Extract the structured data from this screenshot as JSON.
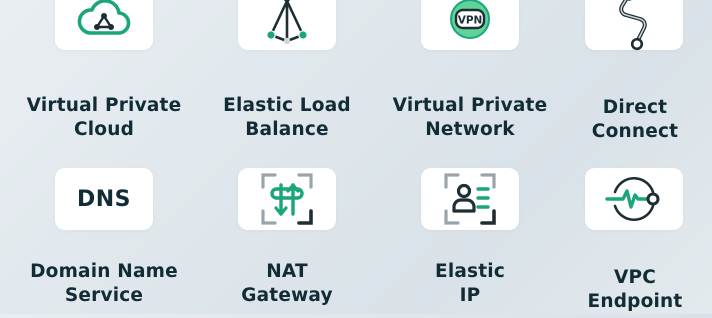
{
  "colors": {
    "accent_green": "#1aa67a",
    "light_green": "#5fd39a",
    "ink": "#1f2e35",
    "label_text": "#122c36",
    "card_bg": "#ffffff"
  },
  "services": [
    {
      "name_line1": "Virtual Private",
      "name_line2": "Cloud",
      "icon": "cloud-network-icon"
    },
    {
      "name_line1": "Elastic Load",
      "name_line2": "Balance",
      "icon": "load-balancer-icon"
    },
    {
      "name_line1": "Virtual Private",
      "name_line2": "Network",
      "icon": "vpn-icon",
      "icon_text": "VPN"
    },
    {
      "name_line1": "Direct",
      "name_line2": "Connect",
      "icon": "direct-connect-icon"
    },
    {
      "name_line1": "Domain Name",
      "name_line2": "Service",
      "icon": "dns-icon",
      "icon_text": "DNS"
    },
    {
      "name_line1": "NAT",
      "name_line2": "Gateway",
      "icon": "nat-gateway-icon"
    },
    {
      "name_line1": "Elastic",
      "name_line2": "IP",
      "icon": "elastic-ip-icon"
    },
    {
      "name_line1": "VPC",
      "name_line2": "Endpoint",
      "icon": "vpc-endpoint-icon"
    }
  ]
}
